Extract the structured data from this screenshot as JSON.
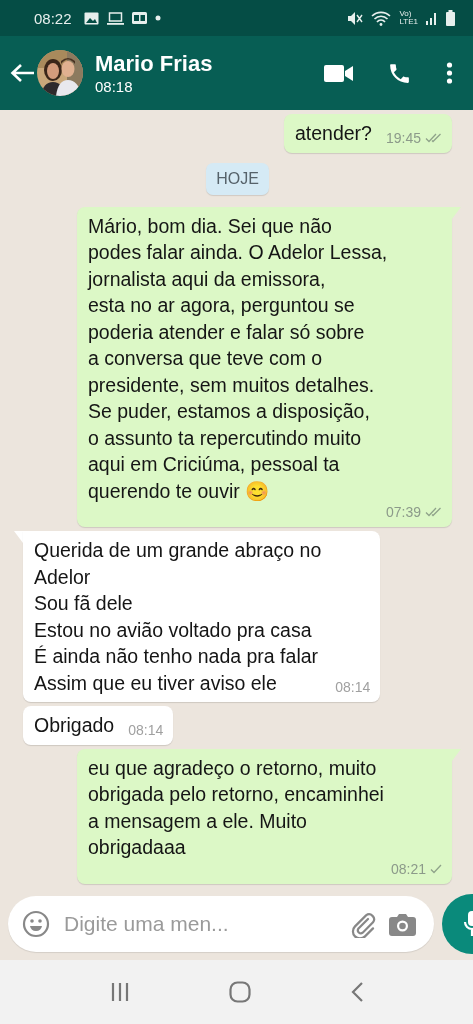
{
  "status_bar": {
    "time": "08:22",
    "network_top": "Vo)",
    "network_bottom": "LTE1"
  },
  "header": {
    "contact_name": "Mario Frias",
    "subtitle": "08:18"
  },
  "messages": [
    {
      "kind": "out",
      "text": "atender?",
      "time": "19:45",
      "delivered": true,
      "tail": false
    },
    {
      "kind": "date",
      "text": "HOJE"
    },
    {
      "kind": "out",
      "text": "Mário, bom dia. Sei que não\npodes falar ainda. O Adelor Lessa,\njornalista aqui da emissora,\nesta no ar agora, perguntou se\npoderia atender e falar só sobre\na conversa que teve com o\npresidente, sem muitos detalhes.\nSe puder, estamos a disposição,\no assunto ta repercutindo muito\naqui em Criciúma, pessoal ta\nquerendo te ouvir 😊",
      "time": "07:39",
      "delivered": true,
      "tail": true
    },
    {
      "kind": "in",
      "text": "Querida de um grande abraço no\nAdelor\nSou fã dele\nEstou no avião voltado pra casa\nÉ ainda não tenho nada pra falar\nAssim que eu tiver aviso ele",
      "time": "08:14",
      "tail": true
    },
    {
      "kind": "in",
      "text": "Obrigado",
      "time": "08:14",
      "tail": false
    },
    {
      "kind": "out",
      "text": "eu que agradeço o retorno, muito\nobrigada pelo retorno, encaminhei\na mensagem a ele. Muito\nobrigadaaa",
      "time": "08:21",
      "delivered": false,
      "tail": true
    }
  ],
  "composer": {
    "placeholder": "Digite uma men..."
  }
}
